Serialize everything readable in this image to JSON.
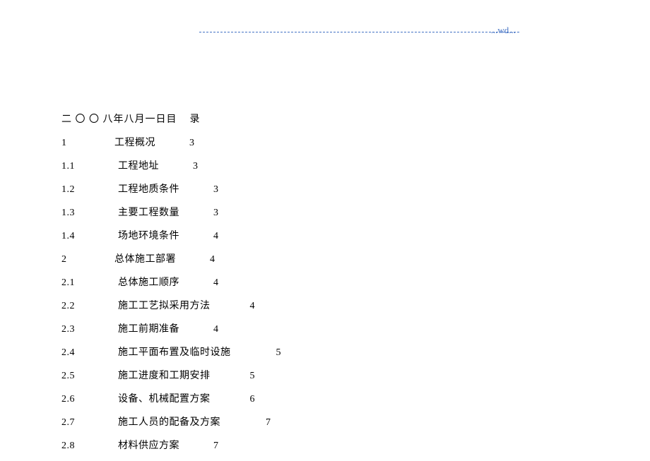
{
  "header": {
    "label": "...wd..."
  },
  "title": {
    "date": "二 〇 〇 八年八月一日目",
    "lu": "录"
  },
  "toc": [
    {
      "num": "1",
      "label": "工程概况",
      "page": "3",
      "indent": false,
      "pad1": 10,
      "pad2": 12
    },
    {
      "num": "1.1",
      "label": "工程地址",
      "page": "3",
      "indent": true,
      "pad1": 8,
      "pad2": 12
    },
    {
      "num": "1.2",
      "label": "工程地质条件",
      "page": "3",
      "indent": true,
      "pad1": 8,
      "pad2": 12
    },
    {
      "num": "1.3",
      "label": "主要工程数量",
      "page": "3",
      "indent": true,
      "pad1": 8,
      "pad2": 12
    },
    {
      "num": "1.4",
      "label": "场地环境条件",
      "page": "4",
      "indent": true,
      "pad1": 8,
      "pad2": 12
    },
    {
      "num": "2",
      "label": "总体施工部署",
      "page": "4",
      "indent": false,
      "pad1": 10,
      "pad2": 12
    },
    {
      "num": "2.1",
      "label": "总体施工顺序",
      "page": "4",
      "indent": true,
      "pad1": 8,
      "pad2": 12
    },
    {
      "num": "2.2",
      "label": "施工工艺拟采用方法",
      "page": "4",
      "indent": true,
      "pad1": 8,
      "pad2": 14
    },
    {
      "num": "2.3",
      "label": "施工前期准备",
      "page": "4",
      "indent": true,
      "pad1": 8,
      "pad2": 12
    },
    {
      "num": "2.4",
      "label": "施工平面布置及临时设施",
      "page": "5",
      "indent": true,
      "pad1": 8,
      "pad2": 16
    },
    {
      "num": "2.5",
      "label": "施工进度和工期安排",
      "page": "5",
      "indent": true,
      "pad1": 8,
      "pad2": 14
    },
    {
      "num": "2.6",
      "label": "设备、机械配置方案",
      "page": "6",
      "indent": true,
      "pad1": 8,
      "pad2": 14
    },
    {
      "num": "2.7",
      "label": "施工人员的配备及方案",
      "page": "7",
      "indent": true,
      "pad1": 8,
      "pad2": 16
    },
    {
      "num": "2.8",
      "label": "材料供应方案",
      "page": "7",
      "indent": true,
      "pad1": 8,
      "pad2": 12
    }
  ]
}
